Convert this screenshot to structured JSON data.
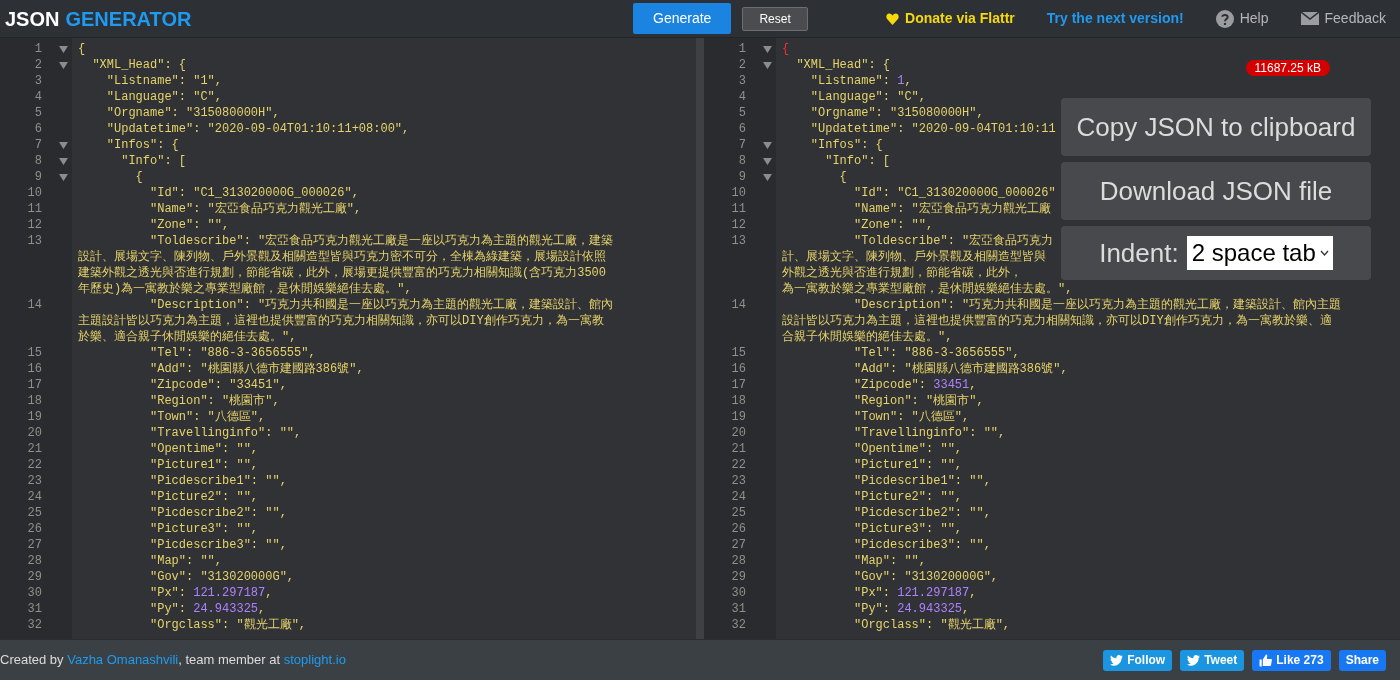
{
  "header": {
    "logo": {
      "first": "JSON",
      "second": "GENERATOR"
    },
    "buttons": [
      {
        "label": "Generate",
        "kind": "primary"
      },
      {
        "label": "Reset",
        "kind": "secondary"
      }
    ],
    "links": [
      {
        "label": "Donate via Flattr",
        "kind": "donate"
      },
      {
        "label": "Try the next version!",
        "kind": "next"
      },
      {
        "label": "Help",
        "kind": "help"
      },
      {
        "label": "Feedback",
        "kind": "feedback"
      }
    ]
  },
  "input_editor": {
    "lines": [
      {
        "n": "1",
        "foldable": true,
        "rows": [
          [
            {
              "kind": "str",
              "text": "{"
            }
          ]
        ]
      },
      {
        "n": "2",
        "foldable": true,
        "rows": [
          [
            {
              "kind": "str",
              "text": "  \"XML_Head\": {"
            }
          ]
        ]
      },
      {
        "n": "3",
        "foldable": false,
        "rows": [
          [
            {
              "kind": "str",
              "text": "    \"Listname\": \"1\","
            }
          ]
        ]
      },
      {
        "n": "4",
        "foldable": false,
        "rows": [
          [
            {
              "kind": "str",
              "text": "    \"Language\": \"C\","
            }
          ]
        ]
      },
      {
        "n": "5",
        "foldable": false,
        "rows": [
          [
            {
              "kind": "str",
              "text": "    \"Orgname\": \"315080000H\","
            }
          ]
        ]
      },
      {
        "n": "6",
        "foldable": false,
        "rows": [
          [
            {
              "kind": "str",
              "text": "    \"Updatetime\": \"2020-09-04T01:10:11+08:00\","
            }
          ]
        ]
      },
      {
        "n": "7",
        "foldable": true,
        "rows": [
          [
            {
              "kind": "str",
              "text": "    \"Infos\": {"
            }
          ]
        ]
      },
      {
        "n": "8",
        "foldable": true,
        "rows": [
          [
            {
              "kind": "str",
              "text": "      \"Info\": ["
            }
          ]
        ]
      },
      {
        "n": "9",
        "foldable": true,
        "rows": [
          [
            {
              "kind": "str",
              "text": "        {"
            }
          ]
        ]
      },
      {
        "n": "10",
        "foldable": false,
        "rows": [
          [
            {
              "kind": "str",
              "text": "          \"Id\": \"C1_313020000G_000026\","
            }
          ]
        ]
      },
      {
        "n": "11",
        "foldable": false,
        "rows": [
          [
            {
              "kind": "str",
              "text": "          \"Name\": \"宏亞食品巧克力觀光工廠\","
            }
          ]
        ]
      },
      {
        "n": "12",
        "foldable": false,
        "rows": [
          [
            {
              "kind": "str",
              "text": "          \"Zone\": \"\","
            }
          ]
        ]
      },
      {
        "n": "13",
        "foldable": false,
        "rows": [
          [
            {
              "kind": "str",
              "text": "          \"Toldescribe\": \"宏亞食品巧克力觀光工廠是一座以巧克力為主題的觀光工廠，建築"
            }
          ],
          [
            {
              "kind": "str",
              "text": "設計、展場文字、陳列物、戶外景觀及相關造型皆與巧克力密不可分，全棟為綠建築，展場設計依照"
            }
          ],
          [
            {
              "kind": "str",
              "text": "建築外觀之透光與否進行規劃，節能省碳，此外，展場更提供豐富的巧克力相關知識(含巧克力3500"
            }
          ],
          [
            {
              "kind": "str",
              "text": "年歷史)為一寓教於樂之專業型廠館，是休閒娛樂絕佳去處。\","
            }
          ]
        ]
      },
      {
        "n": "14",
        "foldable": false,
        "rows": [
          [
            {
              "kind": "str",
              "text": "          \"Description\": \"巧克力共和國是一座以巧克力為主題的觀光工廠，建築設計、館內"
            }
          ],
          [
            {
              "kind": "str",
              "text": "主題設計皆以巧克力為主題，這裡也提供豐富的巧克力相關知識，亦可以DIY創作巧克力，為一寓教"
            }
          ],
          [
            {
              "kind": "str",
              "text": "於樂、適合親子休閒娛樂的絕佳去處。\","
            }
          ]
        ]
      },
      {
        "n": "15",
        "foldable": false,
        "rows": [
          [
            {
              "kind": "str",
              "text": "          \"Tel\": \"886-3-3656555\","
            }
          ]
        ]
      },
      {
        "n": "16",
        "foldable": false,
        "rows": [
          [
            {
              "kind": "str",
              "text": "          \"Add\": \"桃園縣八德市建國路386號\","
            }
          ]
        ]
      },
      {
        "n": "17",
        "foldable": false,
        "rows": [
          [
            {
              "kind": "str",
              "text": "          \"Zipcode\": \"33451\","
            }
          ]
        ]
      },
      {
        "n": "18",
        "foldable": false,
        "rows": [
          [
            {
              "kind": "str",
              "text": "          \"Region\": \"桃園市\","
            }
          ]
        ]
      },
      {
        "n": "19",
        "foldable": false,
        "rows": [
          [
            {
              "kind": "str",
              "text": "          \"Town\": \"八德區\","
            }
          ]
        ]
      },
      {
        "n": "20",
        "foldable": false,
        "rows": [
          [
            {
              "kind": "str",
              "text": "          \"Travellinginfo\": \"\","
            }
          ]
        ]
      },
      {
        "n": "21",
        "foldable": false,
        "rows": [
          [
            {
              "kind": "str",
              "text": "          \"Opentime\": \"\","
            }
          ]
        ]
      },
      {
        "n": "22",
        "foldable": false,
        "rows": [
          [
            {
              "kind": "str",
              "text": "          \"Picture1\": \"\","
            }
          ]
        ]
      },
      {
        "n": "23",
        "foldable": false,
        "rows": [
          [
            {
              "kind": "str",
              "text": "          \"Picdescribe1\": \"\","
            }
          ]
        ]
      },
      {
        "n": "24",
        "foldable": false,
        "rows": [
          [
            {
              "kind": "str",
              "text": "          \"Picture2\": \"\","
            }
          ]
        ]
      },
      {
        "n": "25",
        "foldable": false,
        "rows": [
          [
            {
              "kind": "str",
              "text": "          \"Picdescribe2\": \"\","
            }
          ]
        ]
      },
      {
        "n": "26",
        "foldable": false,
        "rows": [
          [
            {
              "kind": "str",
              "text": "          \"Picture3\": \"\","
            }
          ]
        ]
      },
      {
        "n": "27",
        "foldable": false,
        "rows": [
          [
            {
              "kind": "str",
              "text": "          \"Picdescribe3\": \"\","
            }
          ]
        ]
      },
      {
        "n": "28",
        "foldable": false,
        "rows": [
          [
            {
              "kind": "str",
              "text": "          \"Map\": \"\","
            }
          ]
        ]
      },
      {
        "n": "29",
        "foldable": false,
        "rows": [
          [
            {
              "kind": "str",
              "text": "          \"Gov\": \"313020000G\","
            }
          ]
        ]
      },
      {
        "n": "30",
        "foldable": false,
        "rows": [
          [
            {
              "kind": "str",
              "text": "          \"Px\": "
            },
            {
              "kind": "num",
              "text": "121.297187"
            },
            {
              "kind": "str",
              "text": ","
            }
          ]
        ]
      },
      {
        "n": "31",
        "foldable": false,
        "rows": [
          [
            {
              "kind": "str",
              "text": "          \"Py\": "
            },
            {
              "kind": "num",
              "text": "24.943325"
            },
            {
              "kind": "str",
              "text": ","
            }
          ]
        ]
      },
      {
        "n": "32",
        "foldable": false,
        "rows": [
          [
            {
              "kind": "str",
              "text": "          \"Orgclass\": \"觀光工廠\","
            }
          ]
        ]
      }
    ]
  },
  "output_editor": {
    "size_badge": "11687.25 kB",
    "actions": [
      {
        "label": "Copy JSON to clipboard"
      },
      {
        "label": "Download JSON file"
      }
    ],
    "indent": {
      "label": "Indent:",
      "value": "2 space tab"
    },
    "lines": [
      {
        "n": "1",
        "foldable": true,
        "rows": [
          [
            {
              "kind": "error",
              "text": "{"
            }
          ]
        ]
      },
      {
        "n": "2",
        "foldable": true,
        "rows": [
          [
            {
              "kind": "str",
              "text": "  \"XML_Head\": {"
            }
          ]
        ]
      },
      {
        "n": "3",
        "foldable": false,
        "rows": [
          [
            {
              "kind": "str",
              "text": "    \"Listname\": "
            },
            {
              "kind": "num",
              "text": "1"
            },
            {
              "kind": "str",
              "text": ","
            }
          ]
        ]
      },
      {
        "n": "4",
        "foldable": false,
        "rows": [
          [
            {
              "kind": "str",
              "text": "    \"Language\": \"C\","
            }
          ]
        ]
      },
      {
        "n": "5",
        "foldable": false,
        "rows": [
          [
            {
              "kind": "str",
              "text": "    \"Orgname\": \"315080000H\","
            }
          ]
        ]
      },
      {
        "n": "6",
        "foldable": false,
        "rows": [
          [
            {
              "kind": "str",
              "text": "    \"Updatetime\": \"2020-09-04T01:10:11"
            }
          ]
        ]
      },
      {
        "n": "7",
        "foldable": true,
        "rows": [
          [
            {
              "kind": "str",
              "text": "    \"Infos\": {"
            }
          ]
        ]
      },
      {
        "n": "8",
        "foldable": true,
        "rows": [
          [
            {
              "kind": "str",
              "text": "      \"Info\": ["
            }
          ]
        ]
      },
      {
        "n": "9",
        "foldable": true,
        "rows": [
          [
            {
              "kind": "str",
              "text": "        {"
            }
          ]
        ]
      },
      {
        "n": "10",
        "foldable": false,
        "rows": [
          [
            {
              "kind": "str",
              "text": "          \"Id\": \"C1_313020000G_000026\""
            }
          ]
        ]
      },
      {
        "n": "11",
        "foldable": false,
        "rows": [
          [
            {
              "kind": "str",
              "text": "          \"Name\": \"宏亞食品巧克力觀光工廠"
            }
          ]
        ]
      },
      {
        "n": "12",
        "foldable": false,
        "rows": [
          [
            {
              "kind": "str",
              "text": "          \"Zone\": \"\","
            }
          ]
        ]
      },
      {
        "n": "13",
        "foldable": false,
        "rows": [
          [
            {
              "kind": "str",
              "text": "          \"Toldescribe\": \"宏亞食品巧克力"
            }
          ],
          [
            {
              "kind": "str",
              "text": "計、展場文字、陳列物、戶外景觀及相關造型皆與"
            }
          ],
          [
            {
              "kind": "str",
              "text": "外觀之透光與否進行規劃，節能省碳，此外，"
            }
          ],
          [
            {
              "kind": "str",
              "text": "為一寓教於樂之專業型廠館，是休閒娛樂絕佳去處。\","
            }
          ]
        ]
      },
      {
        "n": "14",
        "foldable": false,
        "rows": [
          [
            {
              "kind": "str",
              "text": "          \"Description\": \"巧克力共和國是一座以巧克力為主題的觀光工廠，建築設計、館內主題"
            }
          ],
          [
            {
              "kind": "str",
              "text": "設計皆以巧克力為主題，這裡也提供豐富的巧克力相關知識，亦可以DIY創作巧克力，為一寓教於樂、適"
            }
          ],
          [
            {
              "kind": "str",
              "text": "合親子休閒娛樂的絕佳去處。\","
            }
          ]
        ]
      },
      {
        "n": "15",
        "foldable": false,
        "rows": [
          [
            {
              "kind": "str",
              "text": "          \"Tel\": \"886-3-3656555\","
            }
          ]
        ]
      },
      {
        "n": "16",
        "foldable": false,
        "rows": [
          [
            {
              "kind": "str",
              "text": "          \"Add\": \"桃園縣八德市建國路386號\","
            }
          ]
        ]
      },
      {
        "n": "17",
        "foldable": false,
        "rows": [
          [
            {
              "kind": "str",
              "text": "          \"Zipcode\": "
            },
            {
              "kind": "num",
              "text": "33451"
            },
            {
              "kind": "str",
              "text": ","
            }
          ]
        ]
      },
      {
        "n": "18",
        "foldable": false,
        "rows": [
          [
            {
              "kind": "str",
              "text": "          \"Region\": \"桃園市\","
            }
          ]
        ]
      },
      {
        "n": "19",
        "foldable": false,
        "rows": [
          [
            {
              "kind": "str",
              "text": "          \"Town\": \"八德區\","
            }
          ]
        ]
      },
      {
        "n": "20",
        "foldable": false,
        "rows": [
          [
            {
              "kind": "str",
              "text": "          \"Travellinginfo\": \"\","
            }
          ]
        ]
      },
      {
        "n": "21",
        "foldable": false,
        "rows": [
          [
            {
              "kind": "str",
              "text": "          \"Opentime\": \"\","
            }
          ]
        ]
      },
      {
        "n": "22",
        "foldable": false,
        "rows": [
          [
            {
              "kind": "str",
              "text": "          \"Picture1\": \"\","
            }
          ]
        ]
      },
      {
        "n": "23",
        "foldable": false,
        "rows": [
          [
            {
              "kind": "str",
              "text": "          \"Picdescribe1\": \"\","
            }
          ]
        ]
      },
      {
        "n": "24",
        "foldable": false,
        "rows": [
          [
            {
              "kind": "str",
              "text": "          \"Picture2\": \"\","
            }
          ]
        ]
      },
      {
        "n": "25",
        "foldable": false,
        "rows": [
          [
            {
              "kind": "str",
              "text": "          \"Picdescribe2\": \"\","
            }
          ]
        ]
      },
      {
        "n": "26",
        "foldable": false,
        "rows": [
          [
            {
              "kind": "str",
              "text": "          \"Picture3\": \"\","
            }
          ]
        ]
      },
      {
        "n": "27",
        "foldable": false,
        "rows": [
          [
            {
              "kind": "str",
              "text": "          \"Picdescribe3\": \"\","
            }
          ]
        ]
      },
      {
        "n": "28",
        "foldable": false,
        "rows": [
          [
            {
              "kind": "str",
              "text": "          \"Map\": \"\","
            }
          ]
        ]
      },
      {
        "n": "29",
        "foldable": false,
        "rows": [
          [
            {
              "kind": "str",
              "text": "          \"Gov\": \"313020000G\","
            }
          ]
        ]
      },
      {
        "n": "30",
        "foldable": false,
        "rows": [
          [
            {
              "kind": "str",
              "text": "          \"Px\": "
            },
            {
              "kind": "num",
              "text": "121.297187"
            },
            {
              "kind": "str",
              "text": ","
            }
          ]
        ]
      },
      {
        "n": "31",
        "foldable": false,
        "rows": [
          [
            {
              "kind": "str",
              "text": "          \"Py\": "
            },
            {
              "kind": "num",
              "text": "24.943325"
            },
            {
              "kind": "str",
              "text": ","
            }
          ]
        ]
      },
      {
        "n": "32",
        "foldable": false,
        "rows": [
          [
            {
              "kind": "str",
              "text": "          \"Orgclass\": \"觀光工廠\","
            }
          ]
        ]
      }
    ]
  },
  "footer": {
    "credit": [
      {
        "kind": "text",
        "text": "Created by "
      },
      {
        "kind": "link",
        "text": "Vazha Omanashvili"
      },
      {
        "kind": "text",
        "text": ", team member at "
      },
      {
        "kind": "link",
        "text": "stoplight.io"
      }
    ],
    "social": [
      {
        "label": "Follow",
        "kind": "twitter"
      },
      {
        "label": "Tweet",
        "kind": "twitter"
      },
      {
        "label": "Like 273",
        "kind": "like"
      },
      {
        "label": "Share",
        "kind": "share"
      }
    ]
  }
}
